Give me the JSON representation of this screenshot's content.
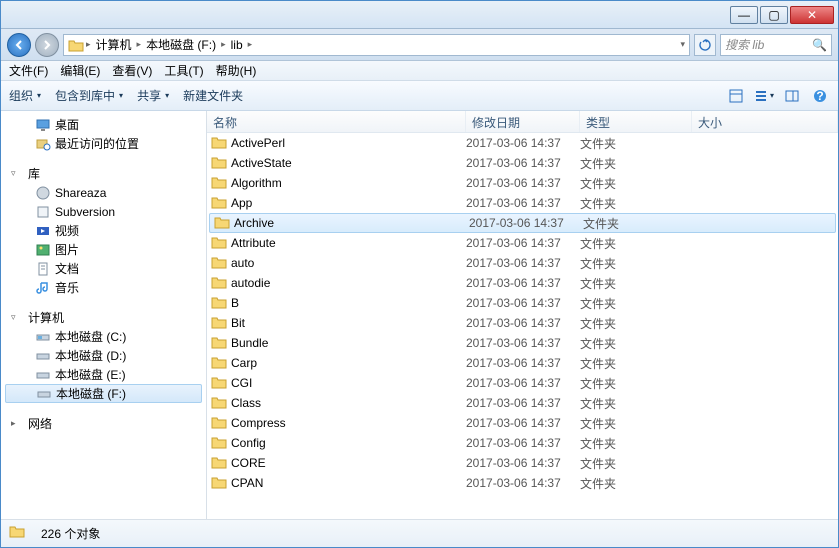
{
  "window": {
    "min": "—",
    "max": "▢",
    "close": "✕"
  },
  "breadcrumb": {
    "items": [
      "计算机",
      "本地磁盘 (F:)",
      "lib"
    ],
    "refresh_tip": "刷新"
  },
  "search": {
    "placeholder": "搜索 lib"
  },
  "menu": {
    "file": "文件(F)",
    "edit": "编辑(E)",
    "view": "查看(V)",
    "tools": "工具(T)",
    "help": "帮助(H)"
  },
  "toolbar": {
    "organize": "组织",
    "include": "包含到库中",
    "share": "共享",
    "newfolder": "新建文件夹"
  },
  "sidebar": {
    "desktop": "桌面",
    "recent": "最近访问的位置",
    "library": "库",
    "shareaza": "Shareaza",
    "subversion": "Subversion",
    "videos": "视频",
    "pictures": "图片",
    "documents": "文档",
    "music": "音乐",
    "computer": "计算机",
    "drive_c": "本地磁盘 (C:)",
    "drive_d": "本地磁盘 (D:)",
    "drive_e": "本地磁盘 (E:)",
    "drive_f": "本地磁盘 (F:)",
    "network": "网络"
  },
  "columns": {
    "name": "名称",
    "date": "修改日期",
    "type": "类型",
    "size": "大小"
  },
  "files": [
    {
      "name": "ActivePerl",
      "date": "2017-03-06 14:37",
      "type": "文件夹",
      "selected": false
    },
    {
      "name": "ActiveState",
      "date": "2017-03-06 14:37",
      "type": "文件夹",
      "selected": false
    },
    {
      "name": "Algorithm",
      "date": "2017-03-06 14:37",
      "type": "文件夹",
      "selected": false
    },
    {
      "name": "App",
      "date": "2017-03-06 14:37",
      "type": "文件夹",
      "selected": false
    },
    {
      "name": "Archive",
      "date": "2017-03-06 14:37",
      "type": "文件夹",
      "selected": true
    },
    {
      "name": "Attribute",
      "date": "2017-03-06 14:37",
      "type": "文件夹",
      "selected": false
    },
    {
      "name": "auto",
      "date": "2017-03-06 14:37",
      "type": "文件夹",
      "selected": false
    },
    {
      "name": "autodie",
      "date": "2017-03-06 14:37",
      "type": "文件夹",
      "selected": false
    },
    {
      "name": "B",
      "date": "2017-03-06 14:37",
      "type": "文件夹",
      "selected": false
    },
    {
      "name": "Bit",
      "date": "2017-03-06 14:37",
      "type": "文件夹",
      "selected": false
    },
    {
      "name": "Bundle",
      "date": "2017-03-06 14:37",
      "type": "文件夹",
      "selected": false
    },
    {
      "name": "Carp",
      "date": "2017-03-06 14:37",
      "type": "文件夹",
      "selected": false
    },
    {
      "name": "CGI",
      "date": "2017-03-06 14:37",
      "type": "文件夹",
      "selected": false
    },
    {
      "name": "Class",
      "date": "2017-03-06 14:37",
      "type": "文件夹",
      "selected": false
    },
    {
      "name": "Compress",
      "date": "2017-03-06 14:37",
      "type": "文件夹",
      "selected": false
    },
    {
      "name": "Config",
      "date": "2017-03-06 14:37",
      "type": "文件夹",
      "selected": false
    },
    {
      "name": "CORE",
      "date": "2017-03-06 14:37",
      "type": "文件夹",
      "selected": false
    },
    {
      "name": "CPAN",
      "date": "2017-03-06 14:37",
      "type": "文件夹",
      "selected": false
    }
  ],
  "status": {
    "count": "226 个对象"
  }
}
